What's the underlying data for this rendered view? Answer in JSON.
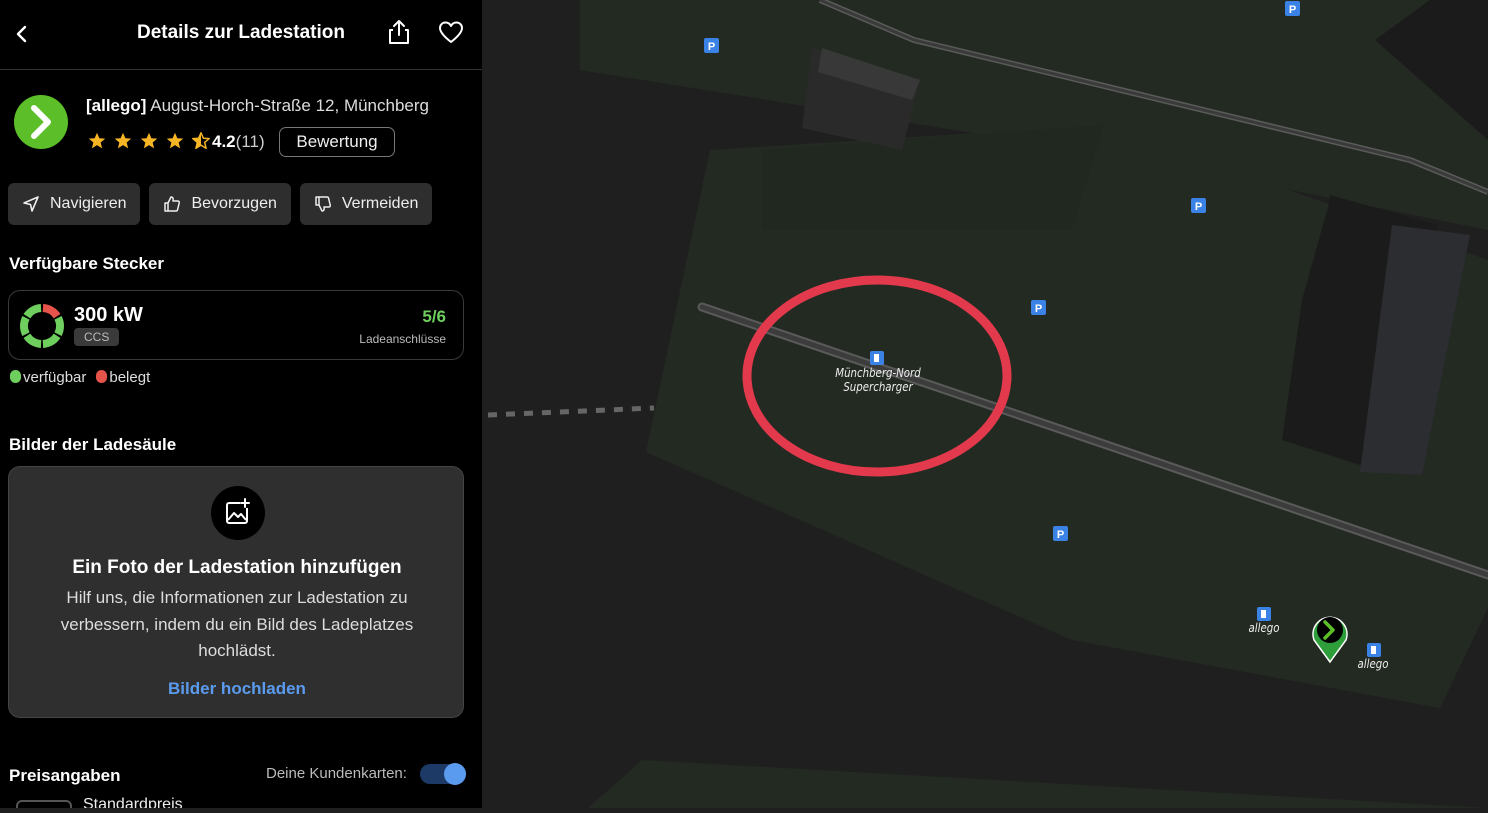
{
  "header": {
    "title": "Details zur Ladestation"
  },
  "station": {
    "operator": "[allego]",
    "address": "August-Horch-Straße 12, Münchberg",
    "rating_value": "4.2",
    "rating_count": "(11)",
    "stars": 4.5,
    "rate_button": "Bewertung",
    "brand_color": "#5cbf2a"
  },
  "actions": {
    "navigate": "Navigieren",
    "prefer": "Bevorzugen",
    "avoid": "Vermeiden"
  },
  "plugs": {
    "section_title": "Verfügbare Stecker",
    "power": "300 kW",
    "type": "CCS",
    "available_count": "5/6",
    "count_label": "Ladeanschlüsse",
    "available": 5,
    "total": 6,
    "legend_available": "verfügbar",
    "legend_occupied": "belegt",
    "color_available": "#6fcf5e",
    "color_occupied": "#e5534b"
  },
  "photos": {
    "section_title": "Bilder der Ladesäule",
    "heading": "Ein Foto der Ladestation hinzufügen",
    "description": "Hilf uns, die Informationen zur Ladestation zu verbessern, indem du ein Bild des Ladeplatzes hochlädst.",
    "upload_link": "Bilder hochladen"
  },
  "pricing": {
    "section_title": "Preisangaben",
    "customer_cards_label": "Deine Kundenkarten:",
    "customer_cards_enabled": true,
    "standard_price_label": "Standardpreis"
  },
  "map": {
    "poi_label_line1": "Münchberg-Nord",
    "poi_label_line2": "Supercharger",
    "allego_label": "allego",
    "parking_icon": "P",
    "highlight_color": "#e23a4c",
    "parking_color": "#3b82e6"
  }
}
